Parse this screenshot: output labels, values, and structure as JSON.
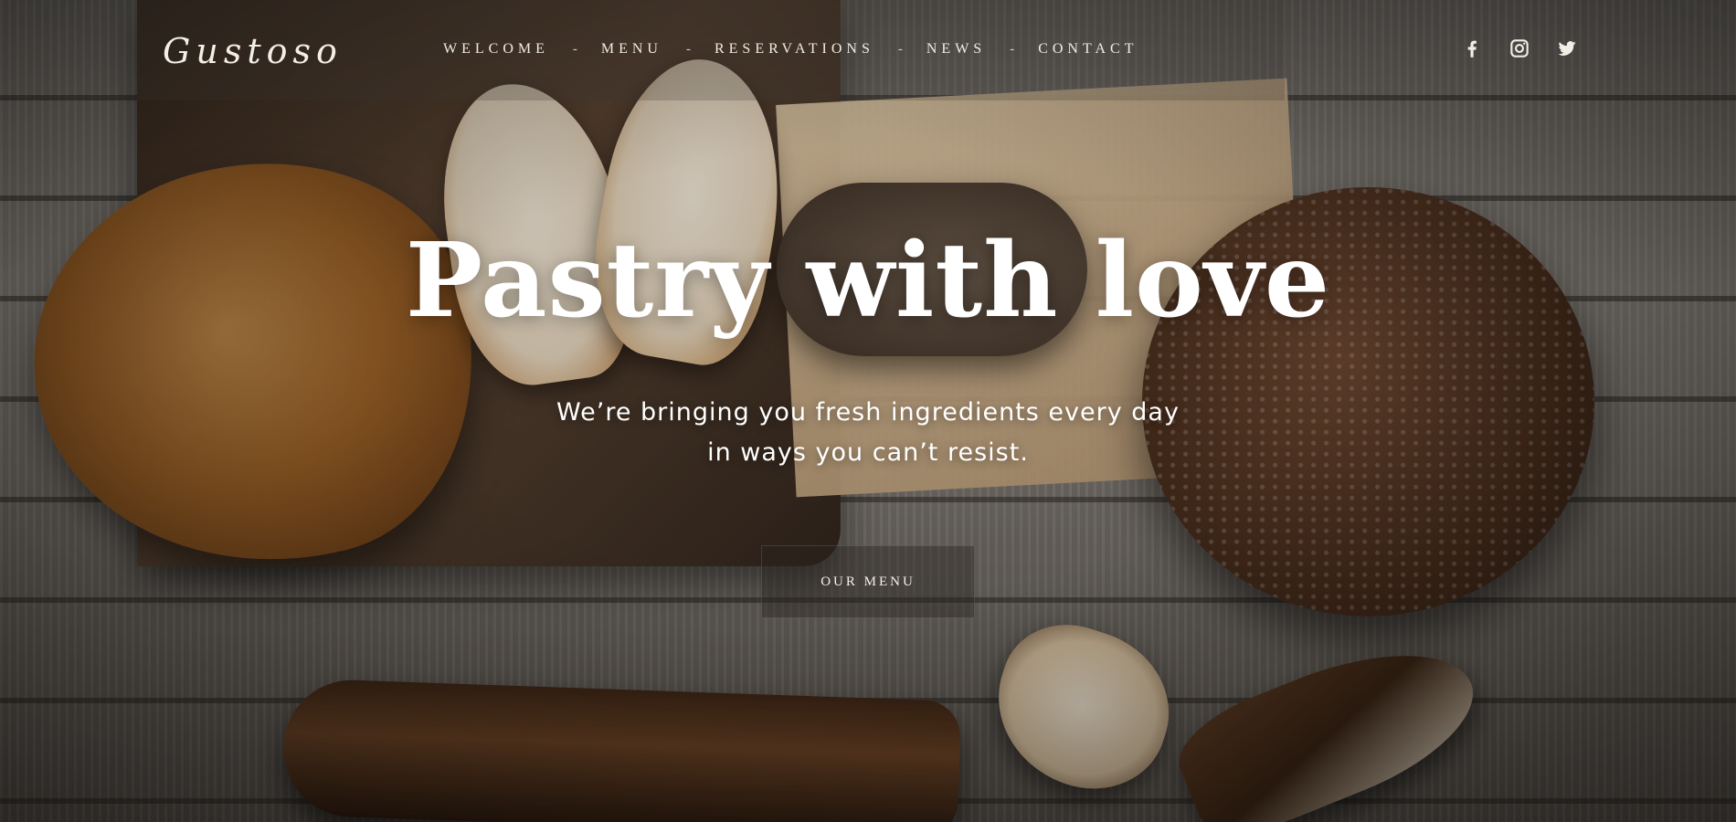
{
  "brand": {
    "logo_text": "Gustoso"
  },
  "nav": {
    "items": [
      {
        "label": "WELCOME"
      },
      {
        "label": "MENU"
      },
      {
        "label": "RESERVATIONS"
      },
      {
        "label": "NEWS"
      },
      {
        "label": "CONTACT"
      }
    ],
    "separator": "-"
  },
  "social": [
    {
      "icon": "facebook-icon"
    },
    {
      "icon": "instagram-icon"
    },
    {
      "icon": "twitter-icon"
    }
  ],
  "hero": {
    "title": "Pastry with love",
    "subtitle_line1": "We’re bringing you fresh ingredients every day",
    "subtitle_line2": "in ways you can’t resist.",
    "cta_label": "OUR MENU"
  },
  "colors": {
    "text": "#ffffff",
    "nav_text": "#f1ece4",
    "button_bg": "rgba(40,36,30,0.42)"
  }
}
